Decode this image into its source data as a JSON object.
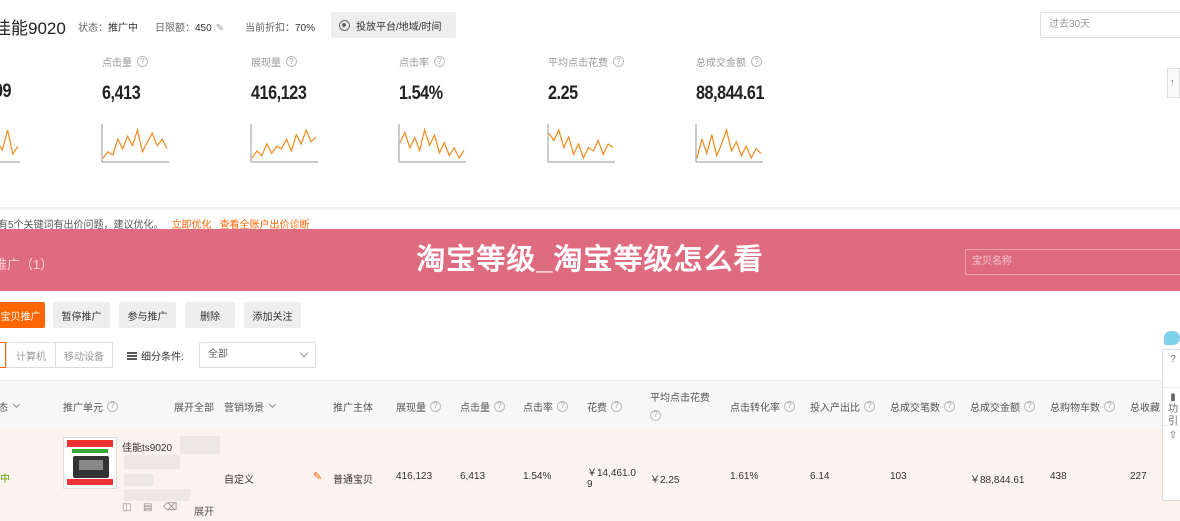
{
  "header": {
    "shop_title": "佳能9020",
    "status_label": "状态：",
    "status_value": "推广中",
    "budget_label": "日限额：",
    "budget_value": "450",
    "discount_label": "当前折扣：",
    "discount_value": "70%",
    "target_button": "投放平台/地域/时间",
    "date_range_placeholder": "过去30天"
  },
  "metrics": [
    {
      "label": "",
      "value": "09"
    },
    {
      "label": "点击量",
      "value": "6,413"
    },
    {
      "label": "展现量",
      "value": "416,123"
    },
    {
      "label": "点击率",
      "value": "1.54%"
    },
    {
      "label": "平均点击花费",
      "value": "2.25"
    },
    {
      "label": "总成交金额",
      "value": "88,844.61"
    }
  ],
  "sparklines": [
    [
      5,
      9,
      7,
      12,
      6,
      8
    ],
    [
      8,
      10,
      9,
      14,
      11,
      15,
      12,
      17,
      10,
      13,
      16,
      12,
      14,
      11
    ],
    [
      6,
      9,
      7,
      12,
      8,
      11,
      10,
      14,
      9,
      16,
      12,
      18,
      13,
      15
    ],
    [
      12,
      16,
      10,
      14,
      9,
      17,
      11,
      15,
      8,
      12,
      7,
      10,
      6,
      9
    ],
    [
      14,
      12,
      15,
      10,
      13,
      8,
      11,
      7,
      10,
      9,
      12,
      8,
      11,
      10
    ],
    [
      8,
      16,
      10,
      18,
      9,
      14,
      20,
      11,
      15,
      9,
      13,
      8,
      12,
      10
    ]
  ],
  "hint": {
    "text": "有5个关键词有出价问题，建议优化。",
    "link1": "立即优化",
    "link2": "查看全账户出价诊断"
  },
  "banner": {
    "title": "淘宝等级_淘宝等级怎么看",
    "tab": "推广（1）",
    "search_placeholder": "宝贝名称"
  },
  "toolbar": {
    "buttons": [
      "宝贝推广",
      "暂停推广",
      "参与推广",
      "删除",
      "添加关注"
    ]
  },
  "filters": {
    "device_tabs": [
      "",
      "计算机",
      "移动设备"
    ],
    "condition_label": "细分条件:",
    "condition_value": "全部"
  },
  "table": {
    "headers": {
      "status": "态",
      "unit": "推广单元",
      "expand_all": "展开全部",
      "scene": "营销场景",
      "subject": "推广主体",
      "impressions": "展现量",
      "clicks": "点击量",
      "ctr": "点击率",
      "cost": "花费",
      "avg_cpc": "平均点击花费",
      "cvr": "点击转化率",
      "roi": "投入产出比",
      "orders": "总成交笔数",
      "gmv": "总成交金额",
      "cart": "总购物车数",
      "fav": "总收藏"
    },
    "row": {
      "status": "中",
      "name": "佳能ts9020",
      "scene": "自定义",
      "subject": "普通宝贝",
      "impressions": "416,123",
      "clicks": "6,413",
      "ctr": "1.54%",
      "cost_line1": "￥14,461.0",
      "cost_line2": "9",
      "avg_cpc": "￥2.25",
      "cvr": "1.61%",
      "roi": "6.14",
      "orders": "103",
      "gmv": "￥88,844.61",
      "cart": "438",
      "fav": "227",
      "expand": "展开"
    }
  },
  "side_panel": {
    "items": [
      "",
      "功\n引",
      ""
    ]
  },
  "colors": {
    "accent": "#ff6600",
    "banner": "#de6b7f",
    "spark": "#f08a1c"
  }
}
